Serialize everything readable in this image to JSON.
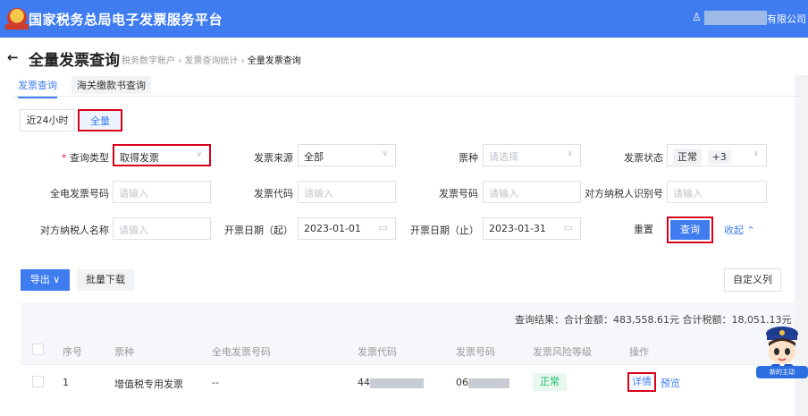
{
  "header": {
    "title": "国家税务总局电子发票服务平台",
    "user_suffix": "有限公司"
  },
  "page": {
    "back": "←",
    "title": "全量发票查询",
    "breadcrumb": [
      "税务数字账户",
      "发票查询统计",
      "全量发票查询"
    ],
    "crumb_sep": "›"
  },
  "tabs": [
    "发票查询",
    "海关缴款书查询"
  ],
  "range": {
    "recent": "近24小时",
    "all": "全量"
  },
  "form": {
    "query_type": {
      "label": "查询类型",
      "required_mark": "*",
      "value": "取得发票"
    },
    "source": {
      "label": "发票来源",
      "value": "全部"
    },
    "ticket_type": {
      "label": "票种",
      "placeholder": "请选择"
    },
    "status": {
      "label": "发票状态",
      "tag": "正常",
      "more": "+3"
    },
    "full_no": {
      "label": "全电发票号码",
      "placeholder": "请输入"
    },
    "code": {
      "label": "发票代码",
      "placeholder": "请输入"
    },
    "number": {
      "label": "发票号码",
      "placeholder": "请输入"
    },
    "taxid": {
      "label": "对方纳税人识别号",
      "placeholder": "请输入"
    },
    "partner": {
      "label": "对方纳税人名称",
      "placeholder": "请输入"
    },
    "date_start": {
      "label": "开票日期（起）",
      "value": "2023-01-01"
    },
    "date_end": {
      "label": "开票日期（止）",
      "value": "2023-01-31"
    },
    "reset": "重置",
    "query": "查询",
    "collapse": "收起 ⌃"
  },
  "toolbar": {
    "export": "导出 ∨",
    "batch": "批量下载",
    "custom": "自定义列"
  },
  "summary": "查询结果：合计金额：483,558.61元   合计税额：18,051.13元",
  "table": {
    "headers": [
      "序号",
      "票种",
      "全电发票号码",
      "发票代码",
      "发票号码",
      "发票风险等级",
      "操作"
    ],
    "row": {
      "index": "1",
      "type": "增值税专用发票",
      "full_no": "--",
      "code_prefix": "44",
      "number_prefix": "06",
      "risk": "正常",
      "detail": "详情",
      "preview": "预览"
    }
  },
  "mascot": {
    "badge": "新的主动"
  }
}
